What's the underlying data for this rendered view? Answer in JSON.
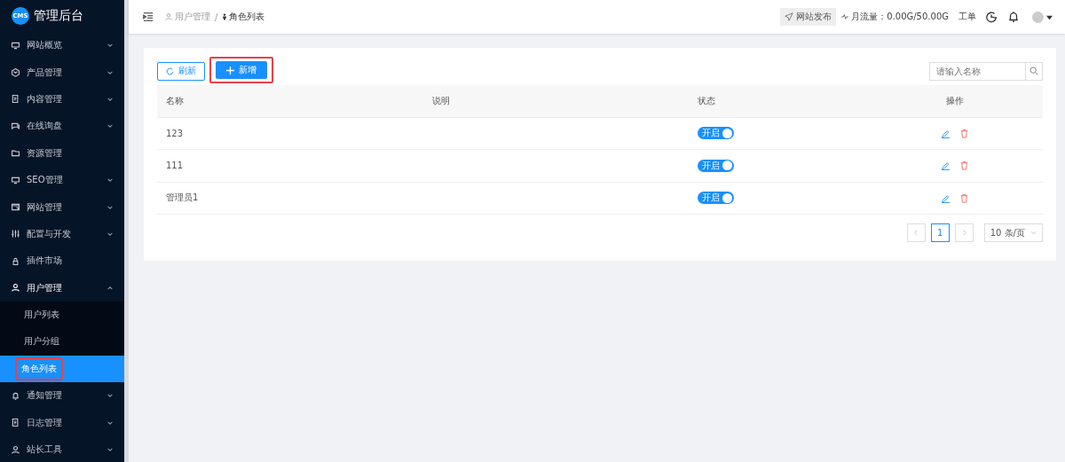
{
  "logo": {
    "badge": "CMS",
    "title": "管理后台"
  },
  "sidebar": {
    "items": [
      {
        "label": "网站概览",
        "expandable": true,
        "expanded": false,
        "selected": false
      },
      {
        "label": "产品管理",
        "expandable": true,
        "expanded": false,
        "selected": false
      },
      {
        "label": "内容管理",
        "expandable": true,
        "expanded": false,
        "selected": false
      },
      {
        "label": "在线询盘",
        "expandable": true,
        "expanded": false,
        "selected": false
      },
      {
        "label": "资源管理",
        "expandable": false,
        "expanded": false,
        "selected": false
      },
      {
        "label": "SEO管理",
        "expandable": true,
        "expanded": false,
        "selected": false
      },
      {
        "label": "网站管理",
        "expandable": true,
        "expanded": false,
        "selected": false
      },
      {
        "label": "配置与开发",
        "expandable": true,
        "expanded": false,
        "selected": false
      },
      {
        "label": "插件市场",
        "expandable": false,
        "expanded": false,
        "selected": false
      },
      {
        "label": "用户管理",
        "expandable": true,
        "expanded": true,
        "selected": false,
        "children": [
          {
            "label": "用户列表",
            "selected": false,
            "highlighted": false
          },
          {
            "label": "用户分组",
            "selected": false,
            "highlighted": false
          },
          {
            "label": "角色列表",
            "selected": true,
            "highlighted": true
          }
        ]
      },
      {
        "label": "通知管理",
        "expandable": true,
        "expanded": false,
        "selected": false
      },
      {
        "label": "日志管理",
        "expandable": true,
        "expanded": false,
        "selected": false
      },
      {
        "label": "站长工具",
        "expandable": true,
        "expanded": false,
        "selected": false
      }
    ]
  },
  "breadcrumb": [
    "用户管理",
    "/",
    "角色列表"
  ],
  "header": {
    "publish": "网站发布",
    "traffic": "月流量：0.00G/50.00G",
    "ticket": "工单"
  },
  "toolbar": {
    "refresh": "刷新",
    "add": "新增",
    "add_highlighted": true,
    "search": {
      "placeholder": "请输入名称"
    }
  },
  "table": {
    "columns": [
      "名称",
      "说明",
      "状态",
      "操作"
    ],
    "rows": [
      {
        "name": "123",
        "status": {
          "on": true,
          "label": "开启"
        }
      },
      {
        "name": "111",
        "status": {
          "on": true,
          "label": "开启"
        }
      },
      {
        "name": "管理员1",
        "status": {
          "on": true,
          "label": "开启"
        }
      }
    ]
  },
  "pagination": {
    "pages": [
      {
        "label": "1",
        "selected": true
      }
    ],
    "page_size": "10 条/页"
  }
}
